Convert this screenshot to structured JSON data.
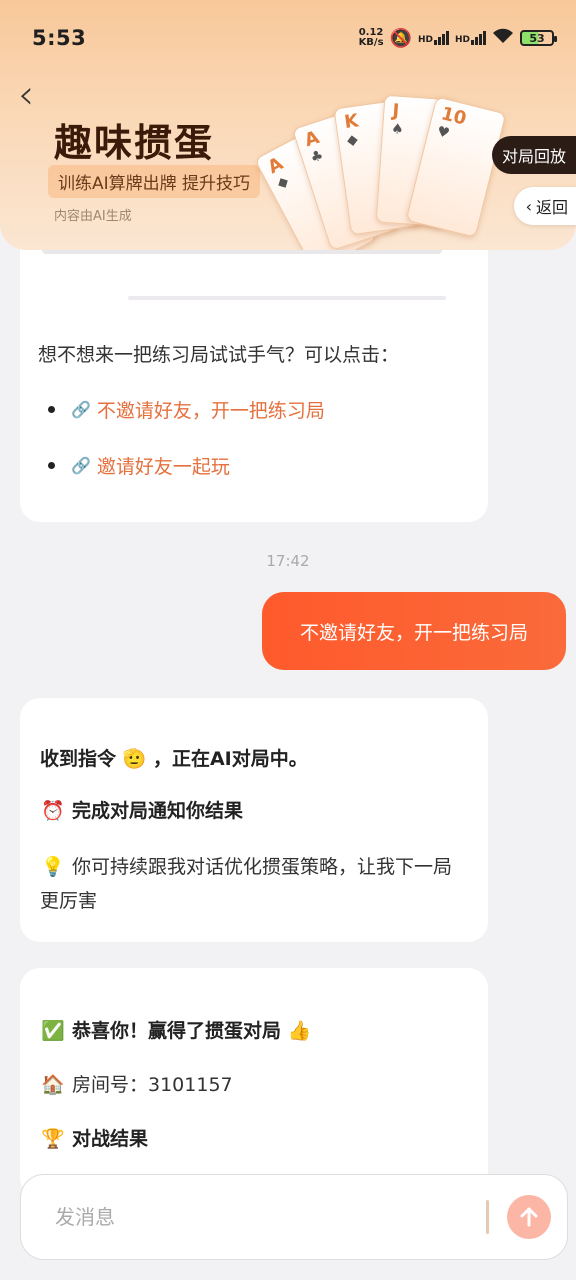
{
  "status_bar": {
    "time": "5:53",
    "net_speed_value": "0.12",
    "net_speed_unit": "KB/s",
    "hd1": "HD",
    "hd2": "HD",
    "battery": "53"
  },
  "header": {
    "title": "趣味掼蛋",
    "subtitle": "训练AI算牌出牌 提升技巧",
    "disclaimer": "内容由AI生成",
    "replay_label": "对局回放",
    "return_label": "返回",
    "cards": [
      "A",
      "A",
      "K",
      "J",
      "10"
    ]
  },
  "messages": {
    "ai_1": {
      "prompt": "想不想来一把练习局试试手气？可以点击：",
      "link_no_invite": "不邀请好友，开一把练习局",
      "link_invite": "邀请好友一起玩"
    },
    "timestamp": "17:42",
    "user_1": "不邀请好友，开一把练习局",
    "ai_2": {
      "line1_prefix": "收到指令",
      "line1_emoji": "🫡",
      "line1_suffix": "，正在AI对局中。",
      "line2_emoji": "⏰",
      "line2": "完成对局通知你结果",
      "line3_emoji": "💡",
      "line3": "你可持续跟我对话优化掼蛋策略，让我下一局更厉害"
    },
    "ai_3": {
      "line1_emoji": "✅",
      "line1": "恭喜你！赢得了掼蛋对局",
      "line1_suffix_emoji": "👍",
      "line2_emoji": "🏠",
      "line2": "房间号：3101157",
      "line3_emoji": "🏆",
      "line3": "对战结果"
    }
  },
  "input": {
    "placeholder": "发消息"
  },
  "colors": {
    "accent": "#ff5a2c",
    "link": "#e5703e",
    "header_gradient_top": "#f8c89a"
  }
}
